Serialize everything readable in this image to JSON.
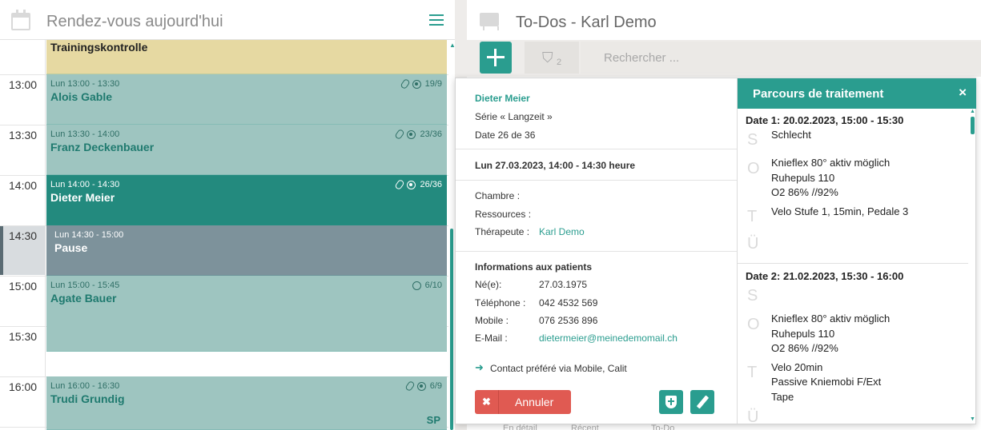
{
  "calendar": {
    "title": "Rendez-vous aujourd'hui",
    "times": [
      "13:00",
      "13:30",
      "14:00",
      "14:30",
      "15:00",
      "15:30",
      "16:00"
    ],
    "appointments": [
      {
        "sub": "",
        "name": "Trainingskontrolle",
        "meta": "",
        "color": "#e6d9a2"
      },
      {
        "sub": "Lun 13:00 - 13:30",
        "name": "Alois Gable",
        "meta": "19/9",
        "color": "#9ec5c0"
      },
      {
        "sub": "Lun 13:30 - 14:00",
        "name": "Franz Deckenbauer",
        "meta": "23/36",
        "color": "#9ec5c0"
      },
      {
        "sub": "Lun 14:00 - 14:30",
        "name": "Dieter Meier",
        "meta": "26/36",
        "color": "#238a7e"
      },
      {
        "sub": "Lun 14:30 - 15:00",
        "name": "Pause",
        "meta": "",
        "color": "#7d929b"
      },
      {
        "sub": "Lun 15:00 - 15:45",
        "name": "Agate Bauer",
        "meta": "6/10",
        "color": "#9ec5c0"
      },
      {
        "sub": "Lun 16:00 - 16:30",
        "name": "Trudi Grundig",
        "meta": "6/9",
        "color": "#9ec5c0",
        "tag": "SP"
      }
    ]
  },
  "todos": {
    "title": "To-Dos - Karl Demo",
    "filter_count": "2",
    "search_placeholder": "Rechercher ...",
    "bottom_tabs": [
      "En détail",
      "Récent",
      "To-Do"
    ]
  },
  "popover": {
    "patient_name": "Dieter Meier",
    "series": "Série « Langzeit »",
    "date_of": "Date 26 de 36",
    "datetime": "Lun 27.03.2023, 14:00 - 14:30 heure",
    "room_label": "Chambre :",
    "resources_label": "Ressources :",
    "therapist_label": "Thérapeute :",
    "therapist": "Karl Demo",
    "patient_info_title": "Informations aux patients",
    "fields": [
      {
        "label": "Né(e):",
        "value": "27.03.1975"
      },
      {
        "label": "Téléphone :",
        "value": "042 4532 569"
      },
      {
        "label": "Mobile :",
        "value": "076 2536 896"
      },
      {
        "label": "E-Mail :",
        "value": "dietermeier@meinedemomail.ch"
      }
    ],
    "contact_pref": "Contact préféré via Mobile, Calit",
    "cancel_label": "Annuler"
  },
  "parcours": {
    "title": "Parcours de traitement",
    "close": "×",
    "soap_letters": [
      "S",
      "O",
      "T",
      "Ü"
    ],
    "entries": [
      {
        "date": "Date 1: 20.02.2023, 15:00 - 15:30",
        "s": [
          "Schlecht"
        ],
        "o": [
          "Knieflex 80° aktiv möglich",
          "Ruhepuls 110",
          "O2 86% //92%"
        ],
        "t": [
          "Velo Stufe 1, 15min, Pedale 3"
        ]
      },
      {
        "date": "Date 2: 21.02.2023, 15:30 - 16:00",
        "s": [],
        "o": [
          "Knieflex 80° aktiv möglich",
          "Ruhepuls 110",
          "O2 86% //92%"
        ],
        "t": [
          "Velo 20min",
          "Passive Kniemobi F/Ext",
          "Tape"
        ]
      }
    ]
  },
  "colors": {
    "accent": "#2a9d8f",
    "danger": "#e05a52"
  }
}
